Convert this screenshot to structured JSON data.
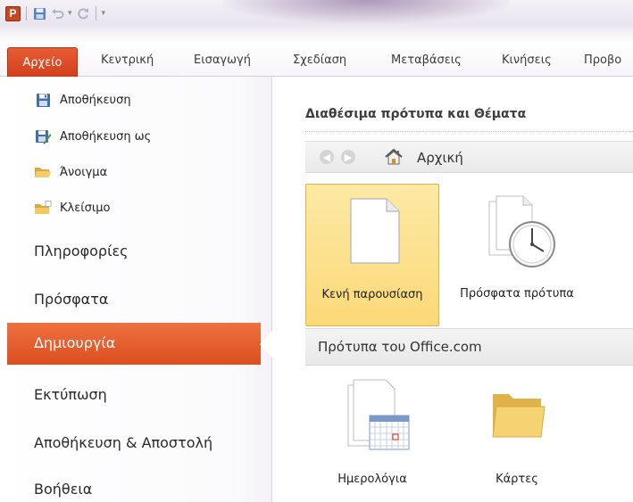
{
  "app": {
    "logo_letter": "P"
  },
  "ribbon": {
    "file_tab": "Αρχείο",
    "tabs": [
      "Κεντρική",
      "Εισαγωγή",
      "Σχεδίαση",
      "Μεταβάσεις",
      "Κινήσεις",
      "Προβο"
    ]
  },
  "backstage": {
    "commands": [
      {
        "label": "Αποθήκευση",
        "icon": "save-icon"
      },
      {
        "label": "Αποθήκευση ως",
        "icon": "save-as-icon"
      },
      {
        "label": "Άνοιγμα",
        "icon": "open-folder-icon"
      },
      {
        "label": "Κλείσιμο",
        "icon": "close-folder-icon"
      }
    ],
    "tabs": [
      "Πληροφορίες",
      "Πρόσφατα",
      "Δημιουργία",
      "Εκτύπωση",
      "Αποθήκευση & Αποστολή",
      "Βοήθεια"
    ],
    "selected_tab": "Δημιουργία"
  },
  "content": {
    "section_title": "Διαθέσιμα πρότυπα και Θέματα",
    "nav": {
      "back_icon": "back-arrow-icon",
      "forward_icon": "forward-arrow-icon",
      "home_icon": "home-icon",
      "home_label": "Αρχική"
    },
    "templates": [
      {
        "label": "Κενή παρουσίαση",
        "icon": "blank-page-icon",
        "selected": true
      },
      {
        "label": "Πρόσφατα πρότυπα",
        "icon": "recent-templates-icon",
        "selected": false
      }
    ],
    "office_section_label": "Πρότυπα του Office.com",
    "office_items": [
      {
        "label": "Ημερολόγια",
        "icon": "calendar-icon"
      },
      {
        "label": "Κάρτες",
        "icon": "folder-icon"
      }
    ]
  },
  "colors": {
    "accent_orange": "#d9481c",
    "selected_tile": "#fbd978"
  }
}
